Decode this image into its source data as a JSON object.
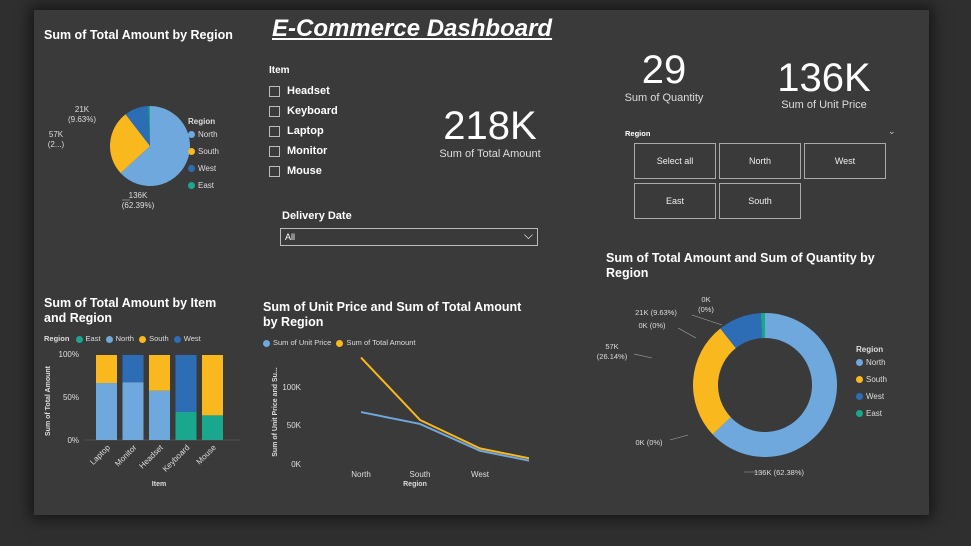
{
  "dashboard_title": "E-Commerce Dashboard",
  "colors": {
    "North": "#6fa8dc",
    "South": "#f9b81e",
    "West": "#2d6db5",
    "East": "#19a88e"
  },
  "region_legend": [
    "North",
    "South",
    "West",
    "East"
  ],
  "pie1": {
    "title": "Sum of Total Amount by Region",
    "legend_title": "Region",
    "label_north": "136K\n(62.39%)",
    "label_south": "57K\n(2...)",
    "label_west": "21K\n(9.63%)"
  },
  "item_filter": {
    "title": "Item",
    "options": [
      "Headset",
      "Keyboard",
      "Laptop",
      "Monitor",
      "Mouse"
    ]
  },
  "delivery": {
    "title": "Delivery Date",
    "value": "All"
  },
  "kpi": {
    "total_amount": {
      "value": "218K",
      "label": "Sum of Total Amount"
    },
    "quantity": {
      "value": "29",
      "label": "Sum of Quantity"
    },
    "unit_price": {
      "value": "136K",
      "label": "Sum of Unit Price"
    }
  },
  "region_slicer": {
    "title": "Region",
    "tiles": [
      "Select all",
      "North",
      "West",
      "East",
      "South"
    ]
  },
  "stacked": {
    "title": "Sum of Total Amount by Item and Region",
    "legend_title": "Region",
    "legend": [
      "East",
      "North",
      "South",
      "West"
    ],
    "ylabel": "Sum of Total Amount",
    "xlabel": "Item",
    "yticks": [
      "100%",
      "50%",
      "0%"
    ]
  },
  "line": {
    "title": "Sum of Unit Price and Sum of Total Amount by Region",
    "legend": [
      "Sum of Unit Price",
      "Sum of Total Amount"
    ],
    "ylabel": "Sum of Unit Price and Su...",
    "xlabel": "Region",
    "yticks": [
      "100K",
      "50K",
      "0K"
    ]
  },
  "donut": {
    "title": "Sum of Total Amount and Sum of Quantity by Region",
    "legend_title": "Region",
    "labels": [
      "0K\n(0%)",
      "21K (9.63%)",
      "0K (0%)",
      "57K\n(26.14%)",
      "0K (0%)",
      "136K (62.38%)"
    ]
  },
  "chart_data": [
    {
      "type": "pie",
      "title": "Sum of Total Amount by Region",
      "categories": [
        "North",
        "South",
        "West",
        "East"
      ],
      "values": [
        136,
        57,
        21,
        1.5
      ],
      "unit": "K"
    },
    {
      "type": "bar",
      "stacked": "percent",
      "title": "Sum of Total Amount by Item and Region",
      "categories": [
        "Laptop",
        "Monitor",
        "Headset",
        "Keyboard",
        "Mouse"
      ],
      "series": [
        {
          "name": "East",
          "values": [
            0,
            0,
            0,
            33,
            29
          ]
        },
        {
          "name": "North",
          "values": [
            67,
            68,
            58,
            0,
            0
          ]
        },
        {
          "name": "South",
          "values": [
            33,
            0,
            42,
            0,
            71
          ]
        },
        {
          "name": "West",
          "values": [
            0,
            32,
            0,
            67,
            0
          ]
        }
      ],
      "ylim": [
        0,
        100
      ],
      "ylabel": "Sum of Total Amount",
      "xlabel": "Item"
    },
    {
      "type": "line",
      "title": "Sum of Unit Price and Sum of Total Amount by Region",
      "categories": [
        "North",
        "South",
        "West",
        "East"
      ],
      "series": [
        {
          "name": "Sum of Unit Price",
          "values": [
            67,
            52,
            18,
            3
          ]
        },
        {
          "name": "Sum of Total Amount",
          "values": [
            136,
            57,
            21,
            6
          ]
        }
      ],
      "ylim": [
        0,
        140
      ],
      "xlabel": "Region"
    },
    {
      "type": "pie",
      "donut": true,
      "title": "Sum of Total Amount and Sum of Quantity by Region",
      "categories": [
        "North",
        "South",
        "West",
        "East"
      ],
      "values": [
        136,
        57,
        21,
        2
      ]
    }
  ]
}
